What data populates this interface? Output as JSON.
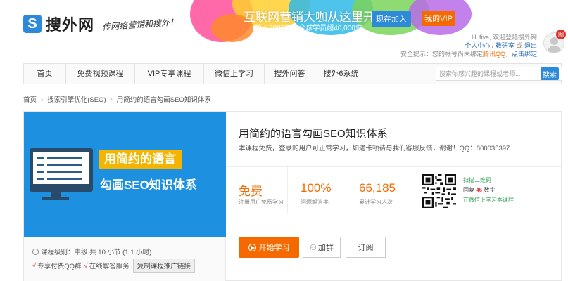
{
  "brand": {
    "name": "搜外网",
    "mark": "S",
    "slogan": "传网络营销和搜外！"
  },
  "promo": {
    "title": "互联网营销大咖从这里开始",
    "subtitle": "始于2007年，全球学员超40,000位",
    "join_label": "现在加入",
    "vip_label": "我的VIP"
  },
  "user": {
    "greeting": "Hi five, 欢迎登陆搜外网",
    "links": [
      "个人中心",
      "教研室",
      "退出"
    ],
    "or_text": "或",
    "warning_prefix": "安全提示：您的帐号尚未绑定",
    "warning_bind": "腾讯QQ",
    "warning_action": "点击绑定",
    "badge": "图"
  },
  "nav": {
    "items": [
      "首页",
      "免费视频课程",
      "VIP专享课程",
      "微信上学习",
      "搜外问答",
      "搜外6系统"
    ],
    "search_placeholder": "搜索你感兴趣的课程或老师...",
    "search_label": "搜索"
  },
  "breadcrumb": [
    "首页",
    "搜索引擎优化(SEO)",
    "用简约的语言勾画SEO知识体系"
  ],
  "course": {
    "cover_line1": "用简约的语言",
    "cover_line2": "勾画SEO知识体系",
    "title": "用简约的语言勾画SEO知识体系",
    "description": "本课程免费，登录的用户可正常学习，如遇卡顿请与我们客服反馈，谢谢！QQ：800035397",
    "level_text": "课程级别：中级   共 10 小节 (1.1 小时)",
    "services": [
      "专享付费QQ群",
      "在线解答服务"
    ],
    "copy_label": "复制课程推广链接",
    "stats": [
      {
        "value": "免费",
        "label": "注册用户免费学习",
        "color": "#f56a00"
      },
      {
        "value": "100%",
        "label": "问题解答率",
        "color": "#f56a00"
      },
      {
        "value": "66,185",
        "label": "累计学习人次",
        "color": "#f56a00"
      }
    ],
    "qr": {
      "line1": "扫描二维码",
      "line2_prefix": "回复",
      "line2_num": "46",
      "line2_suffix": "数字",
      "line3": "在微信上学习本课程"
    },
    "start_label": "开始学习",
    "group_label": "加群",
    "subscribe_label": "订阅"
  },
  "colors": {
    "accent": "#f56a00",
    "brand": "#2c8ad8",
    "cover_bg": "#1e90e0",
    "cover_tag": "#f5b400"
  }
}
